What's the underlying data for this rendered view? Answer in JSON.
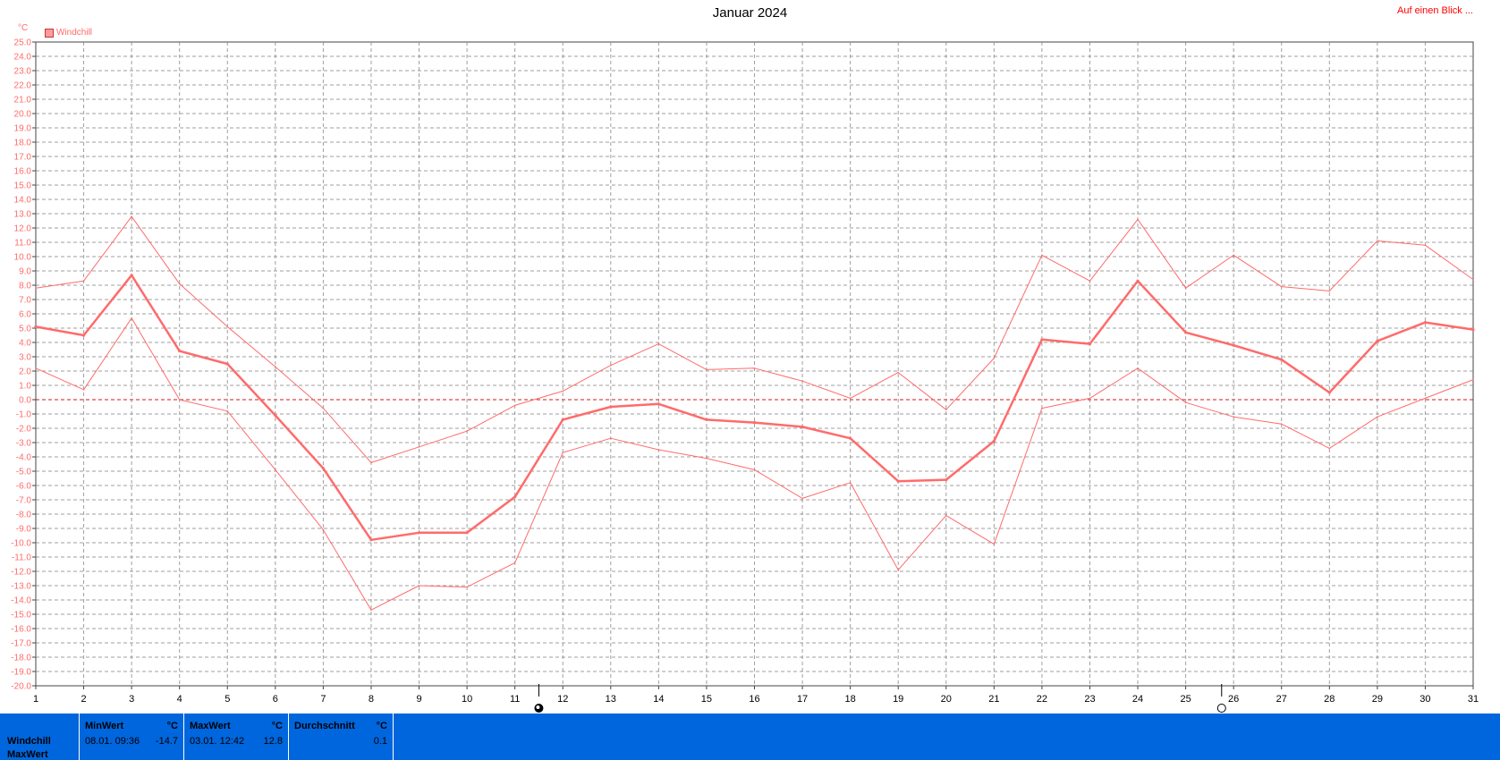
{
  "title": "Januar 2024",
  "top_link": "Auf einen Blick ...",
  "unit": "°C",
  "legend_label": "Windchill",
  "colors": {
    "line": "#ff6b6b",
    "zero_line": "#cc0000",
    "grid": "#888888",
    "stats_bg": "#0066dd"
  },
  "chart_data": {
    "type": "line",
    "title": "Januar 2024",
    "ylabel": "°C",
    "xlabel": "",
    "ylim": [
      -20,
      25
    ],
    "y_step": 1,
    "grid": true,
    "legend_placement": "top-left",
    "x": [
      1,
      2,
      3,
      4,
      5,
      6,
      7,
      8,
      9,
      10,
      11,
      12,
      13,
      14,
      15,
      16,
      17,
      18,
      19,
      20,
      21,
      22,
      23,
      24,
      25,
      26,
      27,
      28,
      29,
      30,
      31
    ],
    "series": [
      {
        "name": "Windchill",
        "role": "max",
        "values": [
          7.8,
          8.3,
          12.8,
          8.1,
          5.1,
          2.3,
          -0.6,
          -4.4,
          -3.3,
          -2.2,
          -0.4,
          0.6,
          2.4,
          3.9,
          2.1,
          2.2,
          1.3,
          0.1,
          1.9,
          -0.7,
          2.9,
          10.1,
          8.3,
          12.6,
          7.8,
          10.1,
          7.9,
          7.6,
          11.1,
          10.8,
          8.4
        ]
      },
      {
        "name": "Windchill",
        "role": "avg",
        "values": [
          5.1,
          4.5,
          8.7,
          3.4,
          2.5,
          -1.1,
          -4.8,
          -9.8,
          -9.3,
          -9.3,
          -6.8,
          -1.4,
          -0.5,
          -0.3,
          -1.4,
          -1.6,
          -1.9,
          -2.7,
          -5.7,
          -5.6,
          -2.9,
          4.2,
          3.9,
          8.3,
          4.7,
          3.8,
          2.8,
          0.5,
          4.1,
          5.4,
          4.9
        ]
      },
      {
        "name": "Windchill",
        "role": "min",
        "values": [
          2.2,
          0.7,
          5.7,
          0.0,
          -0.8,
          -4.9,
          -9.1,
          -14.7,
          -13.0,
          -13.1,
          -11.4,
          -3.7,
          -2.7,
          -3.5,
          -4.1,
          -4.9,
          -6.9,
          -5.8,
          -11.9,
          -8.1,
          -10.1,
          -0.6,
          0.1,
          2.2,
          -0.2,
          -1.2,
          -1.7,
          -3.4,
          -1.2,
          0.1,
          1.4
        ]
      }
    ],
    "markers": [
      {
        "symbol": "full-moon",
        "x_pos": 11.5
      },
      {
        "symbol": "new-moon",
        "x_pos": 25.75
      }
    ]
  },
  "stats": {
    "row_label": "Windchill",
    "row_label2": "MaxWert",
    "columns": [
      {
        "head": "MinWert",
        "unit": "°C",
        "date": "08.01.  09:36",
        "value": "-14.7"
      },
      {
        "head": "MaxWert",
        "unit": "°C",
        "date": "03.01.  12:42",
        "value": "12.8"
      },
      {
        "head": "Durchschnitt",
        "unit": "°C",
        "date": "",
        "value": "0.1"
      }
    ]
  }
}
